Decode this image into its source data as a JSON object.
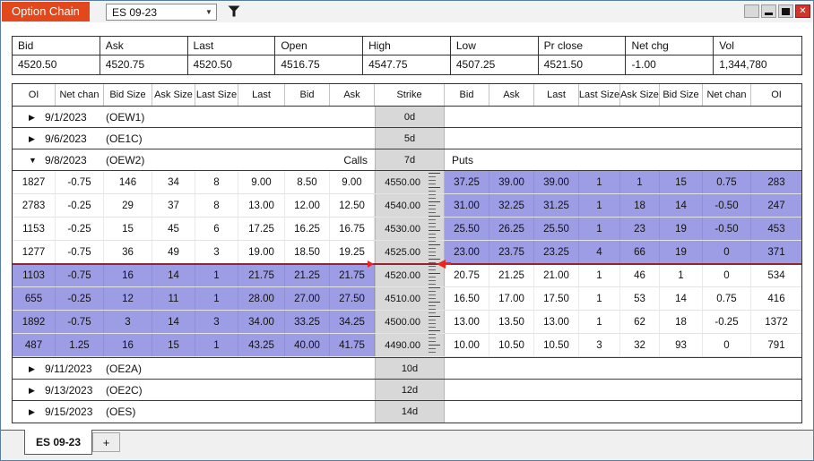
{
  "window": {
    "title": "Option Chain",
    "symbol": "ES 09-23"
  },
  "quote": {
    "columns": [
      "Bid",
      "Ask",
      "Last",
      "Open",
      "High",
      "Low",
      "Pr close",
      "Net chg",
      "Vol"
    ],
    "values": [
      "4520.50",
      "4520.75",
      "4520.50",
      "4516.75",
      "4547.75",
      "4507.25",
      "4521.50",
      "-1.00",
      "1,344,780"
    ]
  },
  "chain": {
    "headers": [
      "OI",
      "Net chan",
      "Bid Size",
      "Ask Size",
      "Last Size",
      "Last",
      "Bid",
      "Ask",
      "Strike",
      "Bid",
      "Ask",
      "Last",
      "Last Size",
      "Ask Size",
      "Bid Size",
      "Net chan",
      "OI"
    ],
    "price_line_after_strike": "4525.00",
    "groups": [
      {
        "date": "9/1/2023",
        "code": "(OEW1)",
        "days": "0d",
        "expanded": false
      },
      {
        "date": "9/6/2023",
        "code": "(OE1C)",
        "days": "5d",
        "expanded": false
      },
      {
        "date": "9/8/2023",
        "code": "(OEW2)",
        "days": "7d",
        "expanded": true,
        "calls_label": "Calls",
        "puts_label": "Puts",
        "rows": [
          {
            "strike": "4550.00",
            "itm": "put",
            "call": [
              "1827",
              "-0.75",
              "146",
              "34",
              "8",
              "9.00",
              "8.50",
              "9.00"
            ],
            "put": [
              "37.25",
              "39.00",
              "39.00",
              "1",
              "1",
              "15",
              "0.75",
              "283"
            ]
          },
          {
            "strike": "4540.00",
            "itm": "put",
            "call": [
              "2783",
              "-0.25",
              "29",
              "37",
              "8",
              "13.00",
              "12.00",
              "12.50"
            ],
            "put": [
              "31.00",
              "32.25",
              "31.25",
              "1",
              "18",
              "14",
              "-0.50",
              "247"
            ]
          },
          {
            "strike": "4530.00",
            "itm": "put",
            "call": [
              "1153",
              "-0.25",
              "15",
              "45",
              "6",
              "17.25",
              "16.25",
              "16.75"
            ],
            "put": [
              "25.50",
              "26.25",
              "25.50",
              "1",
              "23",
              "19",
              "-0.50",
              "453"
            ]
          },
          {
            "strike": "4525.00",
            "itm": "put",
            "call": [
              "1277",
              "-0.75",
              "36",
              "49",
              "3",
              "19.00",
              "18.50",
              "19.25"
            ],
            "put": [
              "23.00",
              "23.75",
              "23.25",
              "4",
              "66",
              "19",
              "0",
              "371"
            ]
          },
          {
            "strike": "4520.00",
            "itm": "call",
            "call": [
              "1103",
              "-0.75",
              "16",
              "14",
              "1",
              "21.75",
              "21.25",
              "21.75"
            ],
            "put": [
              "20.75",
              "21.25",
              "21.00",
              "1",
              "46",
              "1",
              "0",
              "534"
            ]
          },
          {
            "strike": "4510.00",
            "itm": "call",
            "call": [
              "655",
              "-0.25",
              "12",
              "11",
              "1",
              "28.00",
              "27.00",
              "27.50"
            ],
            "put": [
              "16.50",
              "17.00",
              "17.50",
              "1",
              "53",
              "14",
              "0.75",
              "416"
            ]
          },
          {
            "strike": "4500.00",
            "itm": "call",
            "call": [
              "1892",
              "-0.75",
              "3",
              "14",
              "3",
              "34.00",
              "33.25",
              "34.25"
            ],
            "put": [
              "13.00",
              "13.50",
              "13.00",
              "1",
              "62",
              "18",
              "-0.25",
              "1372"
            ]
          },
          {
            "strike": "4490.00",
            "itm": "call",
            "call": [
              "487",
              "1.25",
              "16",
              "15",
              "1",
              "43.25",
              "40.00",
              "41.75"
            ],
            "put": [
              "10.00",
              "10.50",
              "10.50",
              "3",
              "32",
              "93",
              "0",
              "791"
            ]
          }
        ]
      },
      {
        "date": "9/11/2023",
        "code": "(OE2A)",
        "days": "10d",
        "expanded": false
      },
      {
        "date": "9/13/2023",
        "code": "(OE2C)",
        "days": "12d",
        "expanded": false
      },
      {
        "date": "9/15/2023",
        "code": "(OES)",
        "days": "14d",
        "expanded": false
      }
    ]
  },
  "tabs": {
    "active": "ES 09-23",
    "add_label": "+"
  },
  "colors": {
    "accent": "#e2481c",
    "itm_highlight": "#9d9de6",
    "price_line": "#932430",
    "strike_bg": "#d8d8d8"
  }
}
